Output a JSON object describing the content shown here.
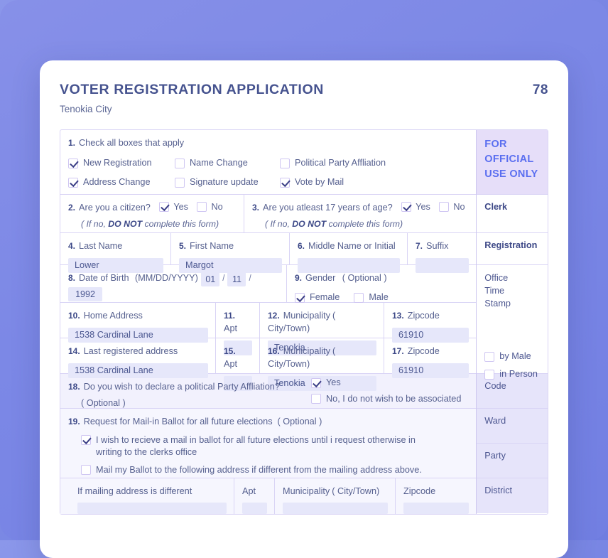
{
  "header": {
    "title": "VOTER REGISTRATION APPLICATION",
    "page_number": "78",
    "subtitle": "Tenokia City"
  },
  "q1": {
    "number": "1.",
    "label": "Check all boxes that apply",
    "options": [
      {
        "label": "New Registration",
        "checked": true
      },
      {
        "label": "Name Change",
        "checked": false
      },
      {
        "label": "Political Party Affliation",
        "checked": false
      },
      {
        "label": "Address Change",
        "checked": true
      },
      {
        "label": "Signature update",
        "checked": false
      },
      {
        "label": "Vote by Mail",
        "checked": true
      }
    ]
  },
  "q2": {
    "number": "2.",
    "label": "Are you a citizen?",
    "yes": "Yes",
    "no": "No",
    "yes_checked": true,
    "no_checked": false,
    "note_pre": "( If no, ",
    "note_bold": "DO NOT",
    "note_post": " complete this form)"
  },
  "q3": {
    "number": "3.",
    "label": "Are you atleast 17 years of age?",
    "yes": "Yes",
    "no": "No",
    "yes_checked": true,
    "no_checked": false,
    "note_pre": "( If no, ",
    "note_bold": "DO NOT",
    "note_post": " complete this form)"
  },
  "q4": {
    "number": "4.",
    "label": "Last Name",
    "value": "Lower"
  },
  "q5": {
    "number": "5.",
    "label": "First Name",
    "value": "Margot"
  },
  "q6": {
    "number": "6.",
    "label": "Middle Name or Initial",
    "value": ""
  },
  "q7": {
    "number": "7.",
    "label": "Suffix",
    "value": ""
  },
  "q8": {
    "number": "8.",
    "label": "Date of Birth",
    "format": "(MM/DD/YYYY)",
    "month": "01",
    "day": "11",
    "year": "1992",
    "separator": "/"
  },
  "q9": {
    "number": "9.",
    "label": "Gender",
    "optional": "( Optional )",
    "options": [
      {
        "label": "Female",
        "checked": true
      },
      {
        "label": "Male",
        "checked": false
      }
    ]
  },
  "q10": {
    "number": "10.",
    "label": "Home Address",
    "value": "1538 Cardinal Lane"
  },
  "q11": {
    "number": "11.",
    "label": "Apt",
    "value": ""
  },
  "q12": {
    "number": "12.",
    "label": "Municipality",
    "label_it": "( City/Town)",
    "value": "Tenokia"
  },
  "q13": {
    "number": "13.",
    "label": "Zipcode",
    "value": "61910"
  },
  "q14": {
    "number": "14.",
    "label": "Last registered address",
    "value": "1538 Cardinal Lane"
  },
  "q15": {
    "number": "15.",
    "label": "Apt",
    "value": ""
  },
  "q16": {
    "number": "16.",
    "label": "Municipality",
    "label_it": "( City/Town)",
    "value": "Tenokia"
  },
  "q17": {
    "number": "17.",
    "label": "Zipcode",
    "value": "61910"
  },
  "q18": {
    "number": "18.",
    "label": "Do you wish to declare a political Party Affliation?",
    "optional": "( Optional )",
    "options": [
      {
        "label": "Yes",
        "checked": true
      },
      {
        "label": "No, I do not wish to be associated",
        "checked": false
      }
    ]
  },
  "q19": {
    "number": "19.",
    "label": "Request for Mail-in Ballot for all future elections",
    "optional": "( Optional )",
    "options": [
      {
        "label": "I wish to recieve a mail in ballot for all future elections until i request otherwise in writing to the clerks office",
        "checked": true
      },
      {
        "label": "Mail my Ballot to the following address if different from the mailing address above.",
        "checked": false
      }
    ]
  },
  "mailing_row": {
    "address_label": "If mailing address is different",
    "apt_label": "Apt",
    "municipality_label": "Municipality",
    "municipality_label_it": "( City/Town)",
    "zipcode_label": "Zipcode",
    "address_value": "",
    "apt_value": "",
    "municipality_value": "",
    "zipcode_value": ""
  },
  "official": {
    "banner_line1": "FOR",
    "banner_line2": "OFFICIAL",
    "banner_line3": "USE ONLY",
    "clerk": "Clerk",
    "registration": "Registration",
    "stamp_line1": "Office",
    "stamp_line2": "Time",
    "stamp_line3": "Stamp",
    "stamp_options": [
      {
        "label": "by Male",
        "checked": false
      },
      {
        "label": "in Person",
        "checked": false
      }
    ],
    "code": "Code",
    "ward": "Ward",
    "party": "Party",
    "district": "District"
  },
  "colors": {
    "backdrop": "#7b88e4",
    "accent": "#5a6ef0",
    "text": "#46538f",
    "input_bg": "#e6e7fa",
    "border": "#d9d4f5"
  }
}
